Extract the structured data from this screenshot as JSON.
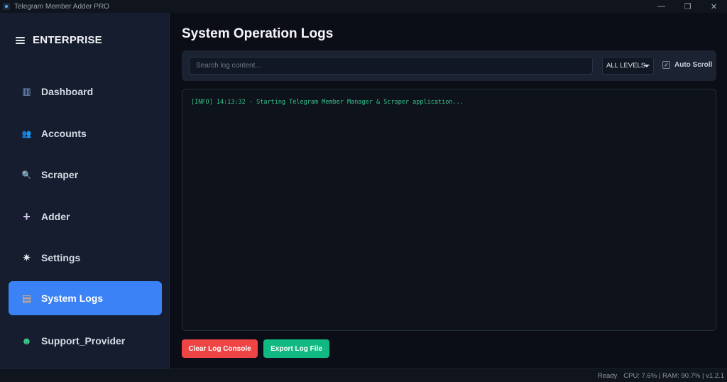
{
  "window": {
    "title": "Telegram Member Adder PRO",
    "controls": {
      "minimize": "—",
      "restore": "❐",
      "close": "✕"
    }
  },
  "sidebar": {
    "brand": "ENTERPRISE",
    "items": [
      {
        "label": "Dashboard",
        "icon": "chart-icon",
        "glyph": "▥",
        "color": "#7fa7d9"
      },
      {
        "label": "Accounts",
        "icon": "users-icon",
        "glyph": "👥",
        "color": "#6f8fe0"
      },
      {
        "label": "Scraper",
        "icon": "magnifier-icon",
        "glyph": "🔍",
        "color": "#5aa0e8"
      },
      {
        "label": "Adder",
        "icon": "plus-icon",
        "glyph": "+",
        "color": "#d6c6f2"
      },
      {
        "label": "Settings",
        "icon": "gear-icon",
        "glyph": "✷",
        "color": "#e4e7ee"
      },
      {
        "label": "System Logs",
        "icon": "notepad-icon",
        "glyph": "▤",
        "color": "#f5b766",
        "active": true
      },
      {
        "label": "Support_Provider",
        "icon": "support-icon",
        "glyph": "☻",
        "color": "#3ecf8e"
      }
    ]
  },
  "main": {
    "title": "System Operation Logs",
    "search": {
      "placeholder": "Search log content...",
      "value": ""
    },
    "level_filter": {
      "selected": "ALL LEVELS"
    },
    "auto_scroll": {
      "label": "Auto Scroll",
      "checked": true
    },
    "logs": [
      "[INFO] 14:13:32 - Starting Telegram Member Manager & Scraper application..."
    ],
    "buttons": {
      "clear": "Clear Log Console",
      "export": "Export Log File"
    }
  },
  "status_bar": {
    "state": "Ready",
    "stats": "CPU: 7.6% | RAM: 90.7% | v1.2.1"
  },
  "colors": {
    "accent": "#3b82f6",
    "danger": "#ef4444",
    "success": "#10b981",
    "log_text": "#34c28a"
  }
}
